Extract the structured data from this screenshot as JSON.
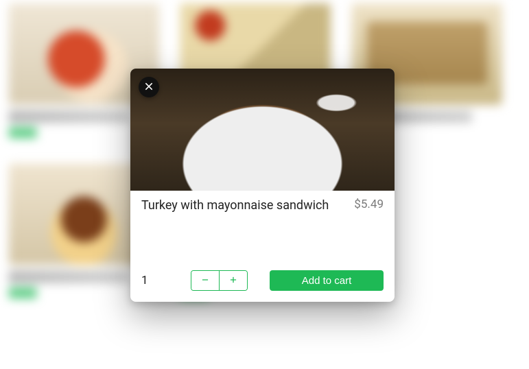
{
  "modal": {
    "title": "Turkey with mayonnaise sandwich",
    "price": "$5.49",
    "quantity": "1",
    "add_to_cart_label": "Add to cart"
  },
  "colors": {
    "accent": "#1eb955"
  }
}
